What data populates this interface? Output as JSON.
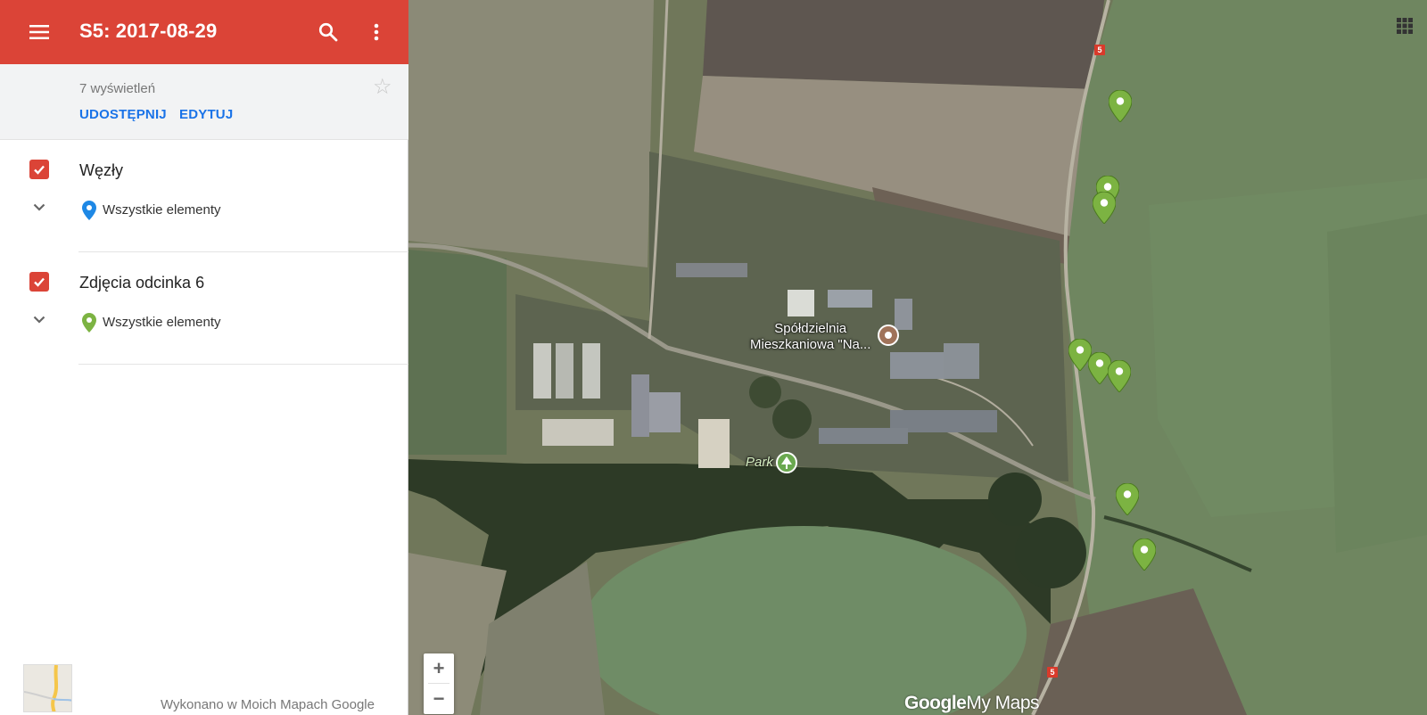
{
  "header": {
    "title": "S5: 2017-08-29",
    "menu_icon": "menu-icon",
    "search_icon": "search-icon",
    "more_icon": "more-vert-icon",
    "color": "#db4437"
  },
  "info": {
    "views": "7 wyświetleń",
    "share_label": "UDOSTĘPNIJ",
    "edit_label": "EDYTUJ",
    "star_icon": "star-outline-icon",
    "action_color": "#1a73e8"
  },
  "layers": [
    {
      "name": "Węzły",
      "checked": true,
      "items_label": "Wszystkie elementy",
      "pin_color": "#1e88e5"
    },
    {
      "name": "Zdjęcia odcinka 6",
      "checked": true,
      "items_label": "Wszystkie elementy",
      "pin_color": "#7cb342"
    }
  ],
  "footer": {
    "text": "Wykonano w Moich Mapach Google"
  },
  "map": {
    "zoom_in": "+",
    "zoom_out": "−",
    "brand_google": "Google",
    "brand_mymaps": "My Maps",
    "poi_coop": "Spółdzielnia\nMieszkaniowa \"Na...",
    "poi_park": "Park",
    "road_number": "5",
    "marker_color": "#7cb342"
  }
}
